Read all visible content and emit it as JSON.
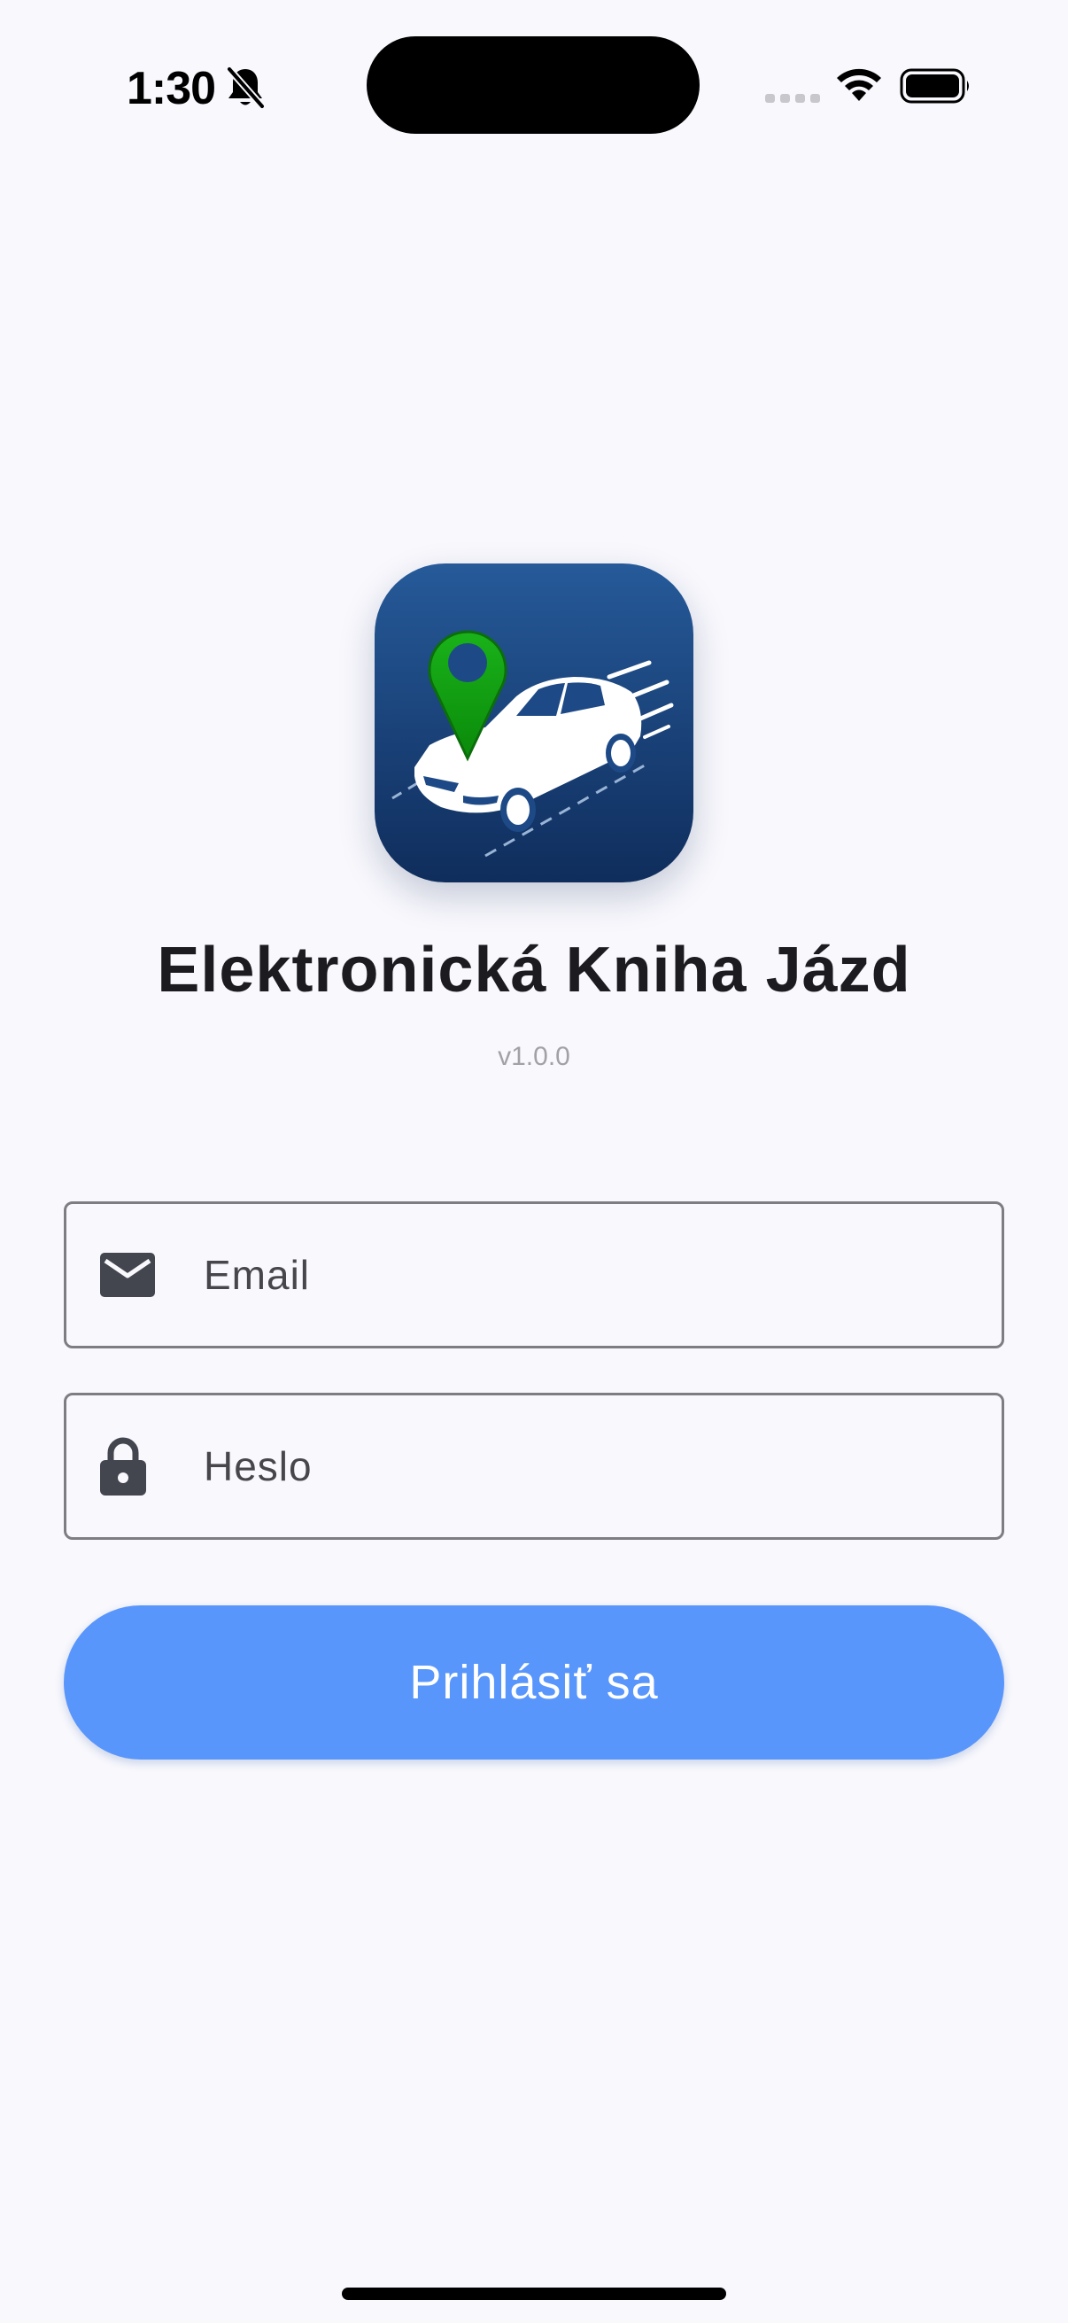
{
  "status_bar": {
    "time": "1:30",
    "icons": [
      "bell-slash-icon",
      "cellular-signal-icon",
      "wifi-icon",
      "battery-icon"
    ]
  },
  "app": {
    "logo_icon": "car-location-pin-logo",
    "title": "Elektronická Kniha Jázd",
    "version": "v1.0.0"
  },
  "login_form": {
    "email": {
      "icon": "mail-icon",
      "placeholder": "Email",
      "value": ""
    },
    "password": {
      "icon": "lock-icon",
      "placeholder": "Heslo",
      "value": ""
    },
    "submit_label": "Prihlásiť sa"
  },
  "colors": {
    "background": "#f8f8fd",
    "primary_button": "#5896fc",
    "logo_background": "#1d4a86",
    "pin_green": "#12a012",
    "field_border": "#7d7d82"
  }
}
